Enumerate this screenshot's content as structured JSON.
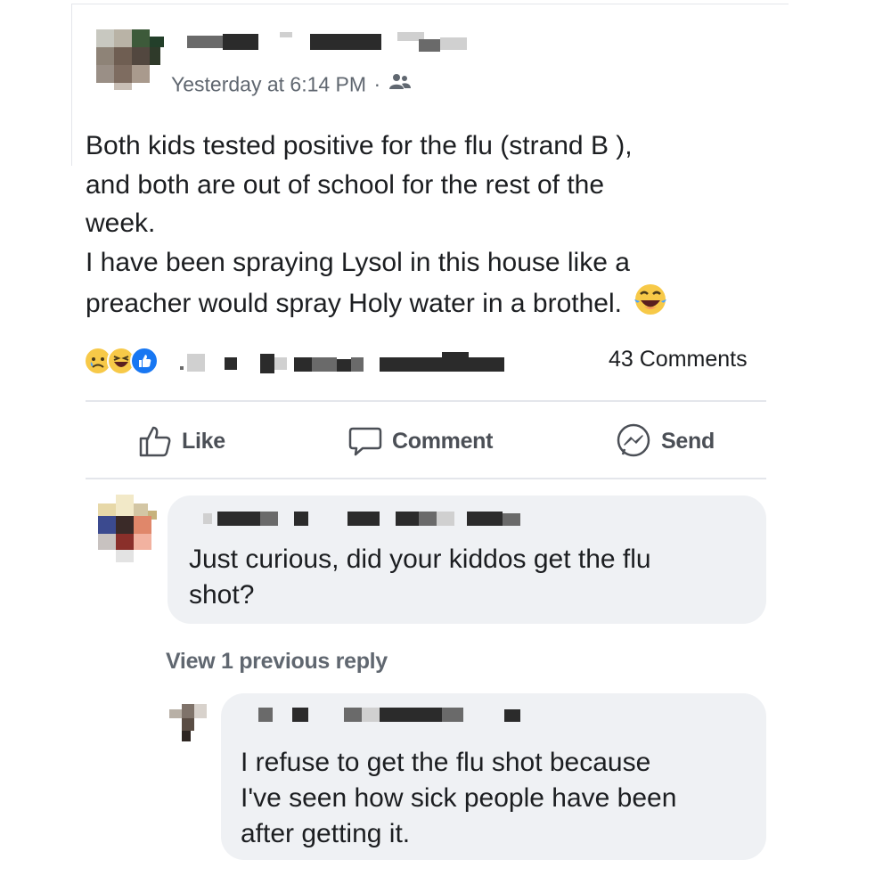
{
  "post": {
    "timestamp": "Yesterday at 6:14 PM",
    "separator": "·",
    "audience_icon": "friends-icon",
    "text_lines": [
      "Both kids tested positive for the flu (strand B ),",
      "and both are out of school for the rest of the",
      "week.",
      "I have been spraying Lysol in this house like a",
      "preacher would spray Holy water in a brothel."
    ],
    "inline_emoji": "laughing-tears-emoji",
    "reactions": [
      "sad-reaction",
      "haha-reaction",
      "like-reaction"
    ],
    "comments_count": "43 Comments"
  },
  "actions": {
    "like_label": "Like",
    "comment_label": "Comment",
    "send_label": "Send"
  },
  "comments": [
    {
      "text_lines": [
        "Just curious, did your kiddos get the flu",
        "shot?"
      ]
    }
  ],
  "view_previous_reply": "View 1 previous reply",
  "replies": [
    {
      "text_lines": [
        "I refuse to get the flu shot because",
        "I've seen how sick people have been",
        "after getting it."
      ]
    }
  ],
  "colors": {
    "bubble": "#eff1f4",
    "secondary_text": "#606770",
    "primary_text": "#1c1e21",
    "like_blue": "#1877f2",
    "reaction_yellow": "#f7c948"
  }
}
